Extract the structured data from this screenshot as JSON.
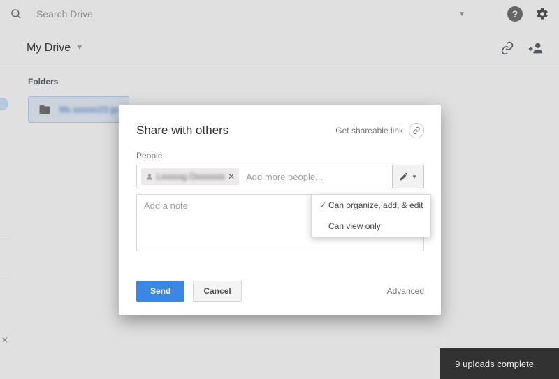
{
  "search": {
    "placeholder": "Search Drive"
  },
  "toolbar": {
    "title": "My Drive"
  },
  "content": {
    "folders_label": "Folders",
    "folder_name_blurred": "Mx xxxxxo23 gma..."
  },
  "modal": {
    "title": "Share with others",
    "shareable_link": "Get shareable link",
    "people_label": "People",
    "chip_name_blurred": "Lxxxxxg Oxxxxxxs",
    "add_more_placeholder": "Add more people...",
    "note_placeholder": "Add a note",
    "permission_options": [
      {
        "label": "Can organize, add, & edit",
        "selected": true
      },
      {
        "label": "Can view only",
        "selected": false
      }
    ],
    "buttons": {
      "send": "Send",
      "cancel": "Cancel",
      "advanced": "Advanced"
    }
  },
  "toast": {
    "message": "9 uploads complete"
  }
}
